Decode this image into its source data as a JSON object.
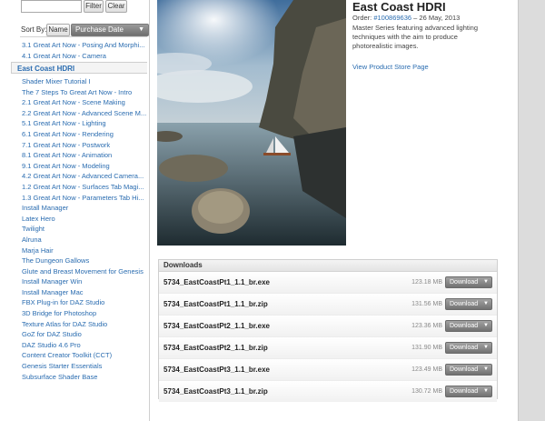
{
  "search": {
    "value": "",
    "placeholder": ""
  },
  "buttons": {
    "filter": "Filter",
    "clear": "Clear"
  },
  "sort": {
    "label": "Sort By:",
    "name": "Name",
    "date": "Purchase Date"
  },
  "list_top": [
    "3.1 Great Art Now - Posing And Morphi...",
    "4.1 Great Art Now - Camera"
  ],
  "selected_item": "East Coast HDRI",
  "list_rest": [
    "Shader Mixer Tutorial I",
    "The 7 Steps To Great Art Now - Intro",
    "2.1 Great Art Now - Scene Making",
    "2.2 Great Art Now - Advanced Scene M...",
    "5.1 Great Art Now - Lighting",
    "6.1 Great Art Now - Rendering",
    "7.1 Great Art Now - Postwork",
    "8.1 Great Art Now - Animation",
    "9.1 Great Art Now - Modeling",
    "4.2 Great Art Now - Advanced Camera...",
    "1.2 Great Art Now - Surfaces Tab Magi...",
    "1.3 Great Art Now - Parameters Tab Hi...",
    "Install Manager",
    "Latex Hero",
    "Twilight",
    "Alruna",
    "Marja Hair",
    "The Dungeon Gallows",
    "Glute and Breast Movement for Genesis",
    "Install Manager Win",
    "Install Manager Mac",
    "FBX Plug-in for DAZ Studio",
    "3D Bridge for Photoshop",
    "Texture Atlas for DAZ Studio",
    "GoZ for DAZ Studio",
    "DAZ Studio 4.6 Pro",
    "Content Creator Toolkit (CCT)",
    "Genesis Starter Essentials",
    "Subsurface Shader Base"
  ],
  "product": {
    "title": "East Coast HDRI",
    "order_prefix": "Order: ",
    "order_number": "#100869636",
    "order_date": " – 26 May, 2013",
    "description": "Master Series featuring advanced lighting techniques with the aim to produce photorealistic images.",
    "store_link": "View Product Store Page"
  },
  "downloads": {
    "header": "Downloads",
    "button_label": "Download",
    "files": [
      {
        "name": "5734_EastCoastPt1_1.1_br.exe",
        "size": "123.18 MB"
      },
      {
        "name": "5734_EastCoastPt1_1.1_br.zip",
        "size": "131.56 MB"
      },
      {
        "name": "5734_EastCoastPt2_1.1_br.exe",
        "size": "123.36 MB"
      },
      {
        "name": "5734_EastCoastPt2_1.1_br.zip",
        "size": "131.90 MB"
      },
      {
        "name": "5734_EastCoastPt3_1.1_br.exe",
        "size": "123.49 MB"
      },
      {
        "name": "5734_EastCoastPt3_1.1_br.zip",
        "size": "130.72 MB"
      }
    ]
  },
  "colors": {
    "link": "#2a6cb0",
    "gutter": "#dcdcdc"
  }
}
